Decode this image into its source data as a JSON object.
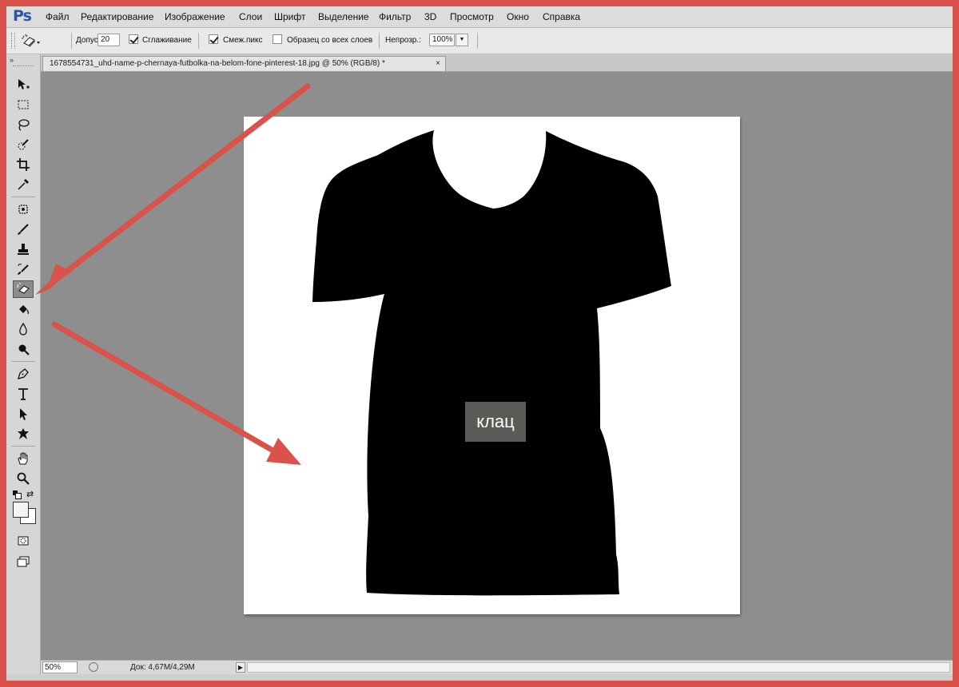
{
  "app": {
    "logo": "Ps"
  },
  "menu": [
    "Файл",
    "Редактирование",
    "Изображение",
    "Слои",
    "Шрифт",
    "Выделение",
    "Фильтр",
    "3D",
    "Просмотр",
    "Окно",
    "Справка"
  ],
  "options": {
    "tolerance_label": "Допуск:",
    "tolerance_value": "20",
    "antialias_label": "Сглаживание",
    "antialias_checked": true,
    "contiguous_label": "Смеж.пикс",
    "contiguous_checked": true,
    "sample_all_label": "Образец со всех слоев",
    "sample_all_checked": false,
    "opacity_label": "Непрозр.:",
    "opacity_value": "100%"
  },
  "document": {
    "tab_title": "1678554731_uhd-name-p-chernaya-futbolka-na-belom-fone-pinterest-18.jpg @ 50%  (RGB/8) *",
    "close_glyph": "×"
  },
  "tools": [
    {
      "name": "move-tool",
      "icon": "move-icon"
    },
    {
      "name": "marquee-tool",
      "icon": "marquee-icon"
    },
    {
      "name": "lasso-tool",
      "icon": "lasso-icon"
    },
    {
      "name": "quick-selection-tool",
      "icon": "quick-selection-icon"
    },
    {
      "name": "crop-tool",
      "icon": "crop-icon"
    },
    {
      "name": "eyedropper-tool",
      "icon": "eyedropper-icon"
    },
    {
      "name": "healing-brush-tool",
      "icon": "healing-icon"
    },
    {
      "name": "brush-tool",
      "icon": "brush-icon"
    },
    {
      "name": "clone-stamp-tool",
      "icon": "stamp-icon"
    },
    {
      "name": "history-brush-tool",
      "icon": "history-brush-icon"
    },
    {
      "name": "magic-eraser-tool",
      "icon": "magic-eraser-icon",
      "active": true
    },
    {
      "name": "paint-bucket-tool",
      "icon": "bucket-icon"
    },
    {
      "name": "blur-tool",
      "icon": "blur-drop-icon"
    },
    {
      "name": "dodge-tool",
      "icon": "dodge-icon"
    },
    {
      "name": "pen-tool",
      "icon": "pen-icon"
    },
    {
      "name": "type-tool",
      "icon": "type-icon"
    },
    {
      "name": "path-selection-tool",
      "icon": "path-arrow-icon"
    },
    {
      "name": "custom-shape-tool",
      "icon": "shape-icon"
    },
    {
      "name": "hand-tool",
      "icon": "hand-icon"
    },
    {
      "name": "zoom-tool",
      "icon": "zoom-icon"
    }
  ],
  "annotation": {
    "label": "клац",
    "arrow_color": "#d9534a"
  },
  "status": {
    "zoom": "50%",
    "doc_info": "Док: 4,67M/4,29M"
  },
  "colors": {
    "accent_frame": "#d9534a",
    "workspace": "#8e8e8e",
    "canvas": "#ffffff",
    "shirt": "#000000",
    "tag": "#5c5a57"
  }
}
